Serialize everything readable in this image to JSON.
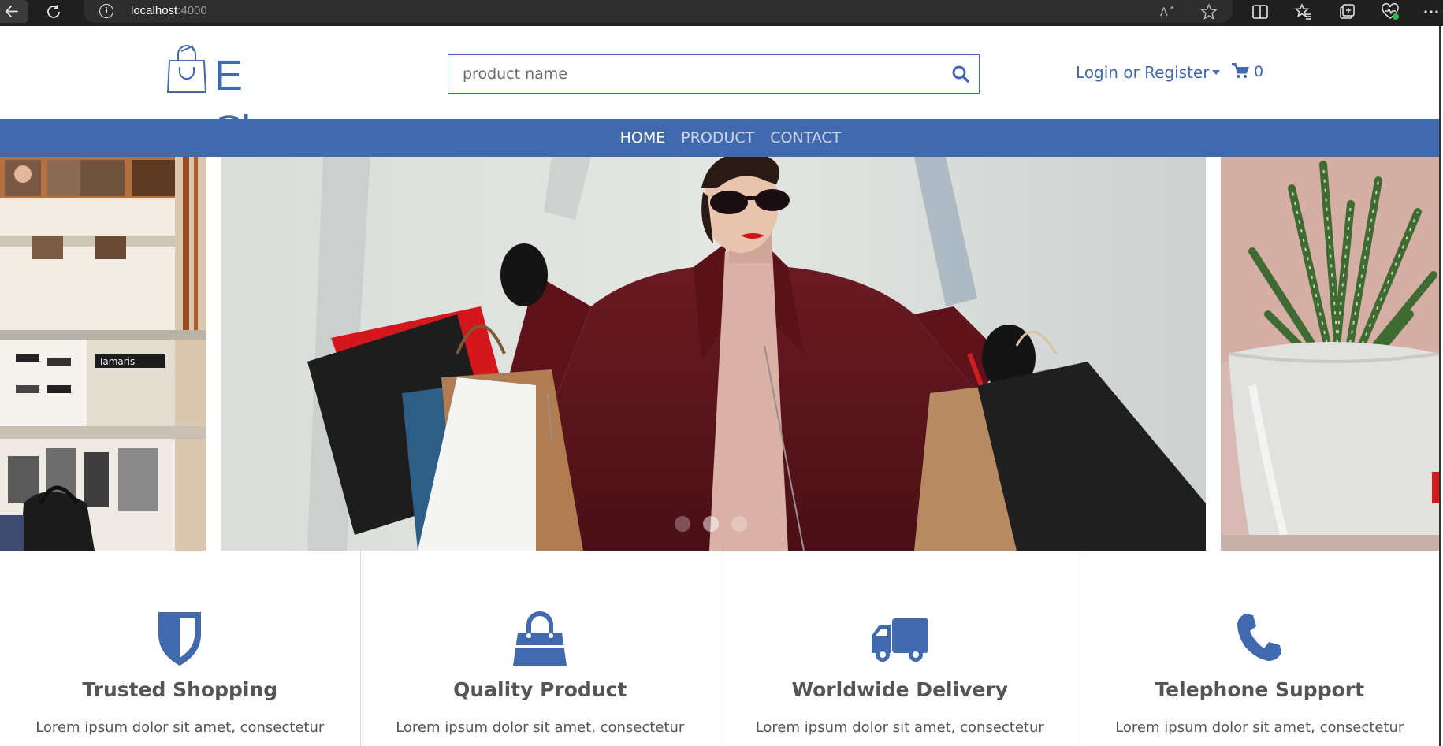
{
  "browser": {
    "url_host": "localhost",
    "url_port": ":4000",
    "info_icon": "i"
  },
  "header": {
    "logo_text": "E Shop",
    "search_placeholder": "product name",
    "login_label": "Login or Register",
    "cart_count": "0"
  },
  "nav": {
    "items": [
      {
        "label": "HOME",
        "active": true
      },
      {
        "label": "PRODUCT",
        "active": false
      },
      {
        "label": "CONTACT",
        "active": false
      }
    ]
  },
  "carousel": {
    "slide_count": 3,
    "active_index": 1
  },
  "features": [
    {
      "icon": "shield-icon",
      "title": "Trusted Shopping",
      "text": "Lorem ipsum dolor sit amet, consectetur"
    },
    {
      "icon": "shopping-bag-icon",
      "title": "Quality Product",
      "text": "Lorem ipsum dolor sit amet, consectetur"
    },
    {
      "icon": "truck-icon",
      "title": "Worldwide Delivery",
      "text": "Lorem ipsum dolor sit amet, consectetur"
    },
    {
      "icon": "phone-icon",
      "title": "Telephone Support",
      "text": "Lorem ipsum dolor sit amet, consectetur"
    }
  ],
  "colors": {
    "brand": "#4169ae",
    "chrome_bg": "#1f1f1f",
    "text_gray": "#555555"
  }
}
